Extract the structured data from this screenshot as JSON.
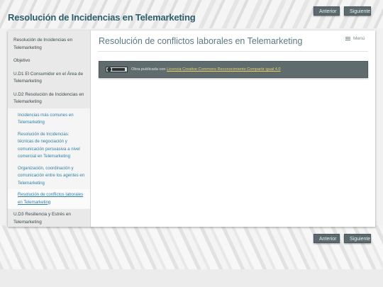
{
  "site": {
    "title": "Resolución de Incidencias en Telemarketing"
  },
  "nav": {
    "prev_label": "Anterior",
    "next_label": "Siguiente"
  },
  "sidebar": {
    "items": [
      {
        "label": "Resolución de Incidencias en Telemarketing"
      },
      {
        "label": "Objetivo"
      },
      {
        "label": "U.D1 El Consumidor en el Área de Telemarketing"
      },
      {
        "label": "U.D2 Resolución de Incidencias en Telemarketing"
      }
    ],
    "subitems": [
      {
        "label": "Incidencias más comunes en Telemarketing"
      },
      {
        "label": "Resolución de Incidencias: técnicas de negociación y comunicación persuasiva a nivel comercial en Telemarketing"
      },
      {
        "label": "Organización, coordinación y comunicación entre los agentes en Telemarketing"
      },
      {
        "label": "Resolución de conflictos laborales en Telemarketing"
      }
    ],
    "after": {
      "label": "U.D3 Resiliencia y Estrés en Telemarketing"
    }
  },
  "main": {
    "menu_label": "Menú",
    "title": "Resolución de conflictos laborales en Telemarketing",
    "license_prefix": "Obra publicada con",
    "license_link": "Licencia Creative Commons Reconocimiento Compartir igual 4.0"
  },
  "colors": {
    "title": "#2e5d6b",
    "button_bg": "#5b6a6d",
    "link": "#2d7fa6",
    "license_bg": "#5f6b6d",
    "license_link": "#e9d36a"
  }
}
